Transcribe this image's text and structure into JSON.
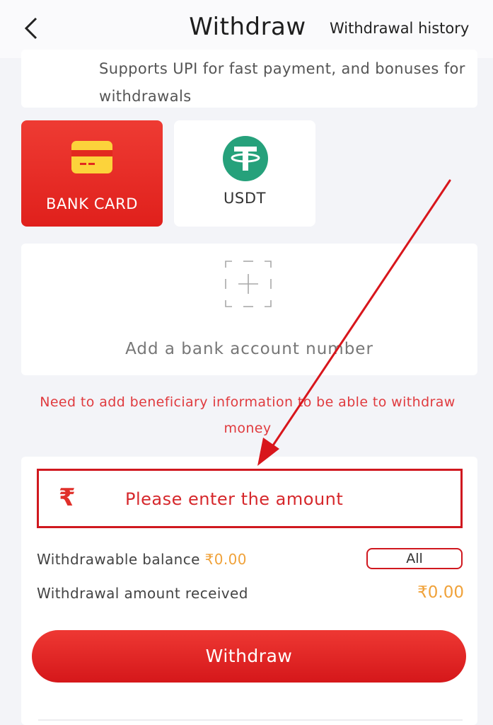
{
  "header": {
    "title": "Withdraw",
    "history_label": "Withdrawal history",
    "back_icon": "chevron-left-icon"
  },
  "info": {
    "text": "Supports UPI for fast payment, and bonuses for withdrawals"
  },
  "methods": [
    {
      "label": "BANK CARD",
      "icon": "bank-card-icon",
      "selected": true
    },
    {
      "label": "USDT",
      "icon": "usdt-icon",
      "selected": false
    }
  ],
  "add_bank": {
    "label": "Add a bank account number",
    "icon": "add-icon"
  },
  "notice": "Need to add beneficiary information to be able to withdraw money",
  "amount": {
    "currency_symbol": "₹",
    "placeholder": "Please enter the amount",
    "value": ""
  },
  "balance": {
    "label": "Withdrawable balance",
    "value": "₹0.00",
    "all_label": "All"
  },
  "received": {
    "label": "Withdrawal amount received",
    "value": "₹0.00"
  },
  "withdraw_button": "Withdraw",
  "colors": {
    "accent": "#e0201c",
    "highlight": "#f0a23a",
    "usdt": "#26a17b",
    "annotation": "#d0181f"
  }
}
